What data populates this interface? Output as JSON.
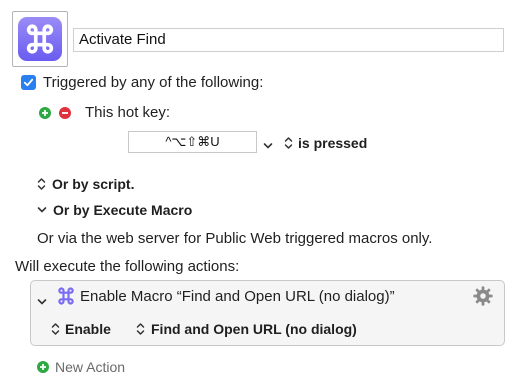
{
  "macro": {
    "name": "Activate Find",
    "icon": "command-icon",
    "accent_color": "#7b6cf2"
  },
  "trigger": {
    "checkbox_label": "Triggered by any of the following:",
    "checked": true,
    "hotkey_label": "This hot key:",
    "hotkey_value": "^⌥⇧⌘U",
    "hotkey_state": "is pressed",
    "by_script": "Or by script.",
    "by_execute_macro": "Or by Execute Macro",
    "web_server_note": "Or via the web server for Public Web triggered macros only."
  },
  "actions": {
    "heading": "Will execute the following actions:",
    "items": [
      {
        "title": "Enable Macro “Find and Open URL (no dialog)”",
        "mode": "Enable",
        "target": "Find and Open URL (no dialog)"
      }
    ],
    "new_action_label": "New Action"
  }
}
